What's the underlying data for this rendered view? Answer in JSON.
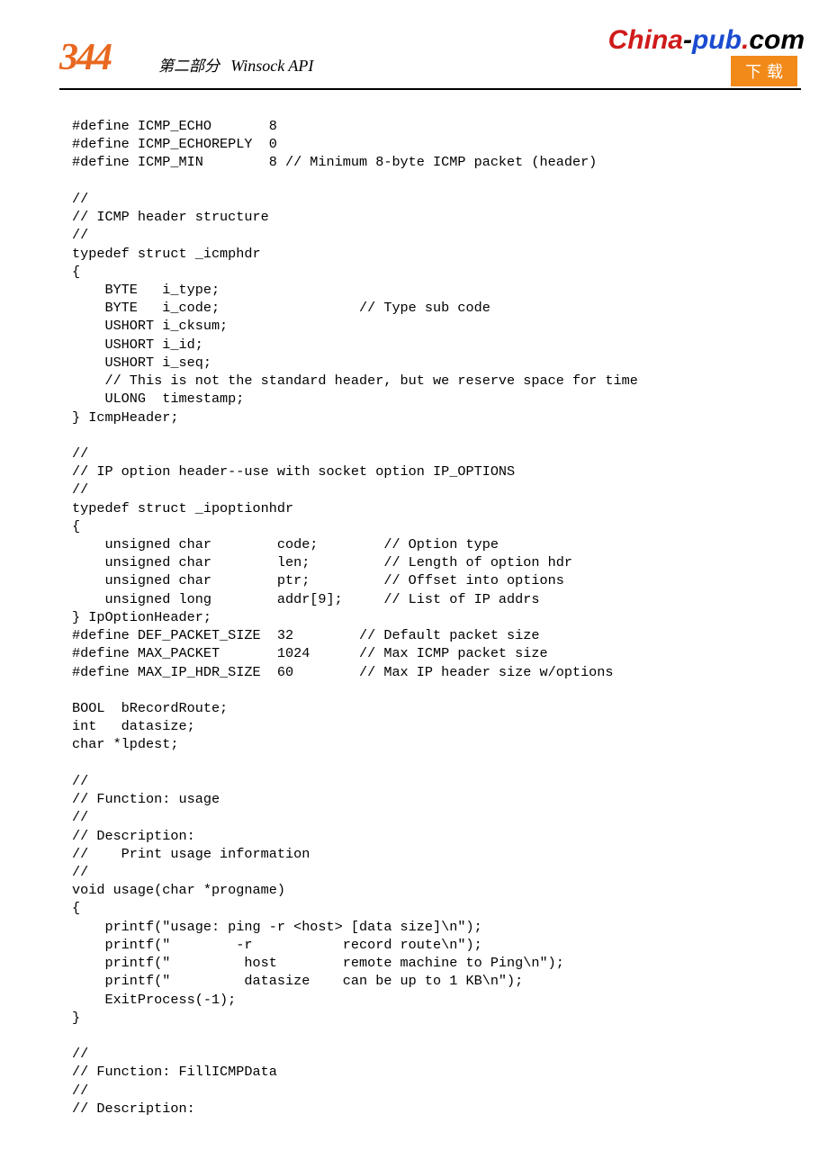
{
  "header": {
    "page_number": "344",
    "section_label": "第二部分",
    "section_api": "Winsock API",
    "logo_china": "China",
    "logo_dash": "-",
    "logo_pub": "pub",
    "logo_dot": ".",
    "logo_com": "com",
    "download_label": "下载"
  },
  "code": "#define ICMP_ECHO       8\n#define ICMP_ECHOREPLY  0\n#define ICMP_MIN        8 // Minimum 8-byte ICMP packet (header)\n\n//\n// ICMP header structure\n//\ntypedef struct _icmphdr\n{\n    BYTE   i_type;\n    BYTE   i_code;                 // Type sub code\n    USHORT i_cksum;\n    USHORT i_id;\n    USHORT i_seq;\n    // This is not the standard header, but we reserve space for time\n    ULONG  timestamp;\n} IcmpHeader;\n\n//\n// IP option header--use with socket option IP_OPTIONS\n//\ntypedef struct _ipoptionhdr\n{\n    unsigned char        code;        // Option type\n    unsigned char        len;         // Length of option hdr\n    unsigned char        ptr;         // Offset into options\n    unsigned long        addr[9];     // List of IP addrs\n} IpOptionHeader;\n#define DEF_PACKET_SIZE  32        // Default packet size\n#define MAX_PACKET       1024      // Max ICMP packet size\n#define MAX_IP_HDR_SIZE  60        // Max IP header size w/options\n\nBOOL  bRecordRoute;\nint   datasize;\nchar *lpdest;\n\n//\n// Function: usage\n//\n// Description:\n//    Print usage information\n//\nvoid usage(char *progname)\n{\n    printf(\"usage: ping -r <host> [data size]\\n\");\n    printf(\"        -r           record route\\n\");\n    printf(\"         host        remote machine to Ping\\n\");\n    printf(\"         datasize    can be up to 1 KB\\n\");\n    ExitProcess(-1);\n}\n\n//\n// Function: FillICMPData\n//\n// Description:"
}
